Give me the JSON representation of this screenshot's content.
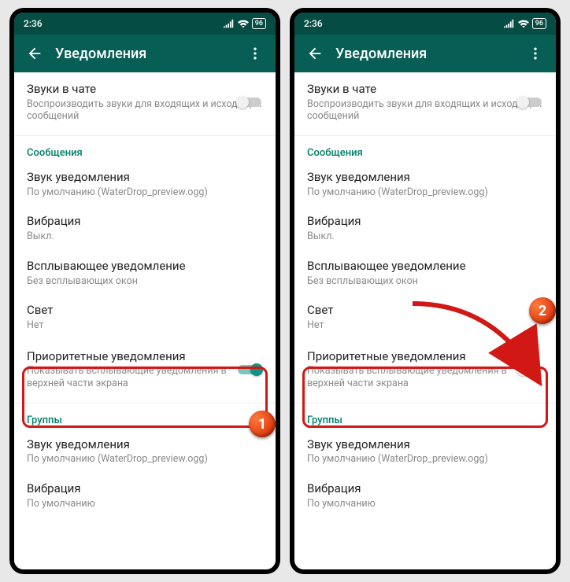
{
  "statusbar": {
    "time": "2:36",
    "battery": "96"
  },
  "appbar": {
    "title": "Уведомления"
  },
  "chat_sounds": {
    "title": "Звуки в чате",
    "sub": "Воспроизводить звуки для входящих и исходящих сообщений"
  },
  "section_messages": "Сообщения",
  "notif_sound": {
    "title": "Звук уведомления",
    "sub": "По умолчанию (WaterDrop_preview.ogg)"
  },
  "vibration": {
    "title": "Вибрация",
    "sub_off": "Выкл.",
    "sub_default": "По умолчанию"
  },
  "popup": {
    "title": "Всплывающее уведомление",
    "sub": "Без всплывающих окон"
  },
  "light": {
    "title": "Свет",
    "sub": "Нет"
  },
  "priority": {
    "title": "Приоритетные уведомления",
    "sub": "Показывать всплывающие уведомления в верхней части экрана"
  },
  "section_groups": "Группы",
  "callouts": {
    "one": "1",
    "two": "2"
  }
}
